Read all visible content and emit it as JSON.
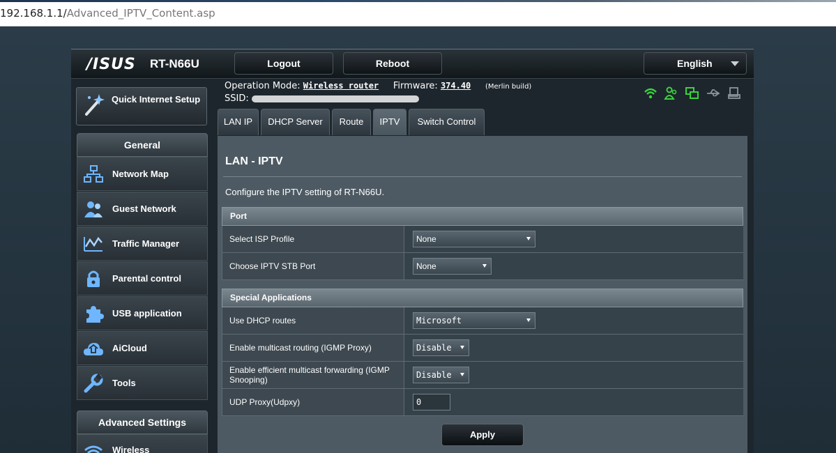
{
  "browser": {
    "url_host": "192.168.1.1/",
    "url_path": "Advanced_IPTV_Content.asp"
  },
  "header": {
    "brand": "/ISUS",
    "model": "RT-N66U",
    "logout_label": "Logout",
    "reboot_label": "Reboot",
    "language": "English"
  },
  "status": {
    "op_mode_label": "Operation Mode:",
    "op_mode_value": "Wireless router",
    "firmware_label": "Firmware:",
    "firmware_value": "374.40",
    "build_note": "(Merlin build)",
    "ssid_label": "SSID:"
  },
  "sidebar": {
    "qis_label": "Quick Internet Setup",
    "general_header": "General",
    "items": [
      {
        "label": "Network Map",
        "icon": "network-map-icon"
      },
      {
        "label": "Guest Network",
        "icon": "guest-network-icon"
      },
      {
        "label": "Traffic Manager",
        "icon": "traffic-manager-icon"
      },
      {
        "label": "Parental control",
        "icon": "lock-icon"
      },
      {
        "label": "USB application",
        "icon": "puzzle-icon"
      },
      {
        "label": "AiCloud",
        "icon": "cloud-icon"
      },
      {
        "label": "Tools",
        "icon": "wrench-icon"
      }
    ],
    "advanced_header": "Advanced Settings",
    "advanced_items": [
      {
        "label": "Wireless",
        "icon": "wifi-icon"
      }
    ]
  },
  "tabs": [
    {
      "label": "LAN IP"
    },
    {
      "label": "DHCP Server"
    },
    {
      "label": "Route"
    },
    {
      "label": "IPTV",
      "active": true
    },
    {
      "label": "Switch Control"
    }
  ],
  "main": {
    "title": "LAN - IPTV",
    "description": "Configure the IPTV setting of RT-N66U.",
    "port_section": {
      "header": "Port",
      "rows": [
        {
          "label": "Select ISP Profile",
          "value": "None"
        },
        {
          "label": "Choose IPTV STB Port",
          "value": "None"
        }
      ]
    },
    "special_section": {
      "header": "Special Applications",
      "rows": [
        {
          "label": "Use DHCP routes",
          "value": "Microsoft"
        },
        {
          "label": "Enable multicast routing (IGMP Proxy)",
          "value": "Disable"
        },
        {
          "label": "Enable efficient multicast forwarding (IGMP Snooping)",
          "value": "Disable"
        },
        {
          "label": "UDP Proxy(Udpxy)",
          "value": "0"
        }
      ]
    },
    "apply_label": "Apply"
  },
  "colors": {
    "status_icon_green": "#39d43c",
    "status_icon_gray": "#8a959c",
    "page_bg": "#24343f"
  }
}
